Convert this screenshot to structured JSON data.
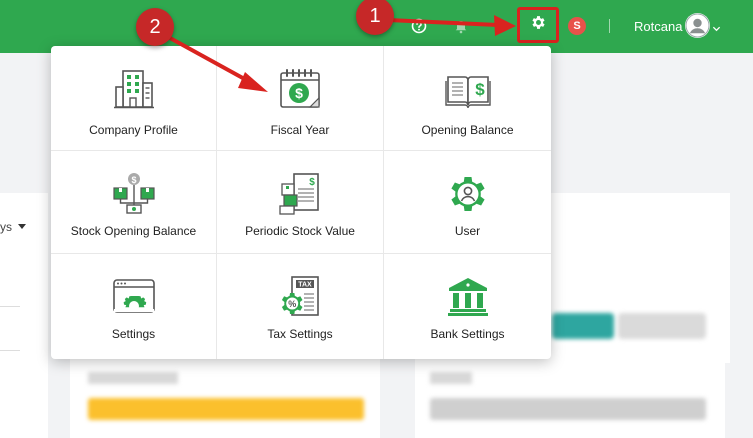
{
  "header": {
    "username": "Rotcana",
    "badge_letter": "S",
    "icons": [
      "help-circle-icon",
      "bell-icon",
      "gear-icon",
      "user-avatar-icon",
      "chevron-down-icon"
    ],
    "brand_color": "#2fa84f"
  },
  "settings_menu": {
    "items": [
      {
        "label": "Company Profile",
        "icon": "building-icon"
      },
      {
        "label": "Fiscal Year",
        "icon": "calendar-dollar-icon"
      },
      {
        "label": "Opening Balance",
        "icon": "ledger-book-icon"
      },
      {
        "label": "Stock Opening Balance",
        "icon": "stock-boxes-icon"
      },
      {
        "label": "Periodic Stock Value",
        "icon": "stock-report-icon"
      },
      {
        "label": "User",
        "icon": "user-gear-icon"
      },
      {
        "label": "Settings",
        "icon": "monitor-gear-icon"
      },
      {
        "label": "Tax Settings",
        "icon": "tax-receipt-icon"
      },
      {
        "label": "Bank Settings",
        "icon": "bank-icon"
      }
    ]
  },
  "background": {
    "filter_label_fragment": "ys"
  },
  "annotations": {
    "step_1": "1",
    "step_2": "2",
    "annotation_color": "#c62828"
  }
}
